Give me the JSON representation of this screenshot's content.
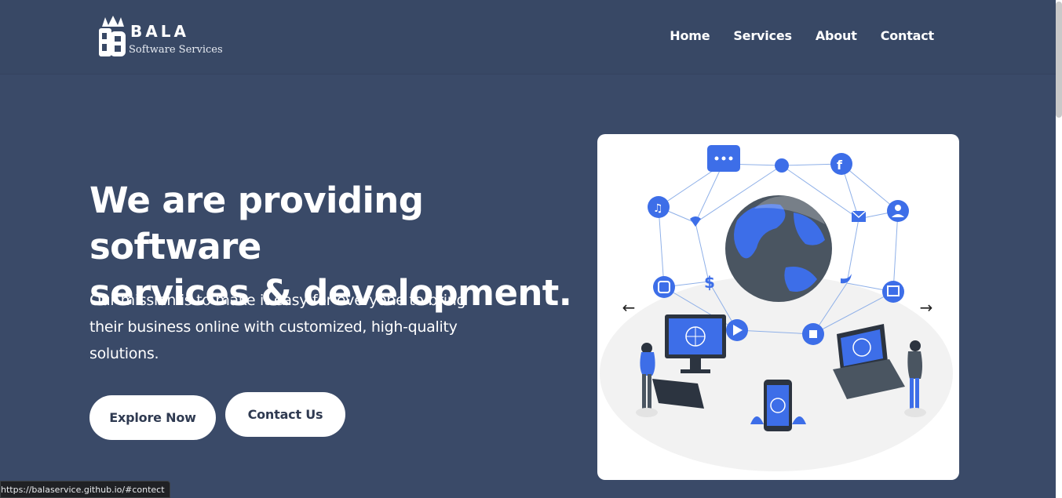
{
  "brand": {
    "title": "BALA",
    "subtitle": "Software Services"
  },
  "nav": {
    "items": [
      {
        "label": "Home"
      },
      {
        "label": "Services"
      },
      {
        "label": "About"
      },
      {
        "label": "Contact"
      }
    ]
  },
  "hero": {
    "title_line1": "We are providing software",
    "title_line2": "services & development.",
    "subtitle": "Our mission is to make it easy for everyone to bring their business online with customized, high-quality solutions.",
    "explore_label": "Explore Now",
    "contact_label": "Contact Us"
  },
  "carousel": {
    "prev_icon": "arrow-left-icon",
    "next_icon": "arrow-right-icon",
    "prev_glyph": "←",
    "next_glyph": "→"
  },
  "status_bar": {
    "url": "https://balaservice.github.io/#contect"
  },
  "colors": {
    "background": "#3a4a68",
    "accent_blue": "#3d6ee8",
    "button_bg": "#ffffff",
    "button_text": "#2f3a51"
  }
}
